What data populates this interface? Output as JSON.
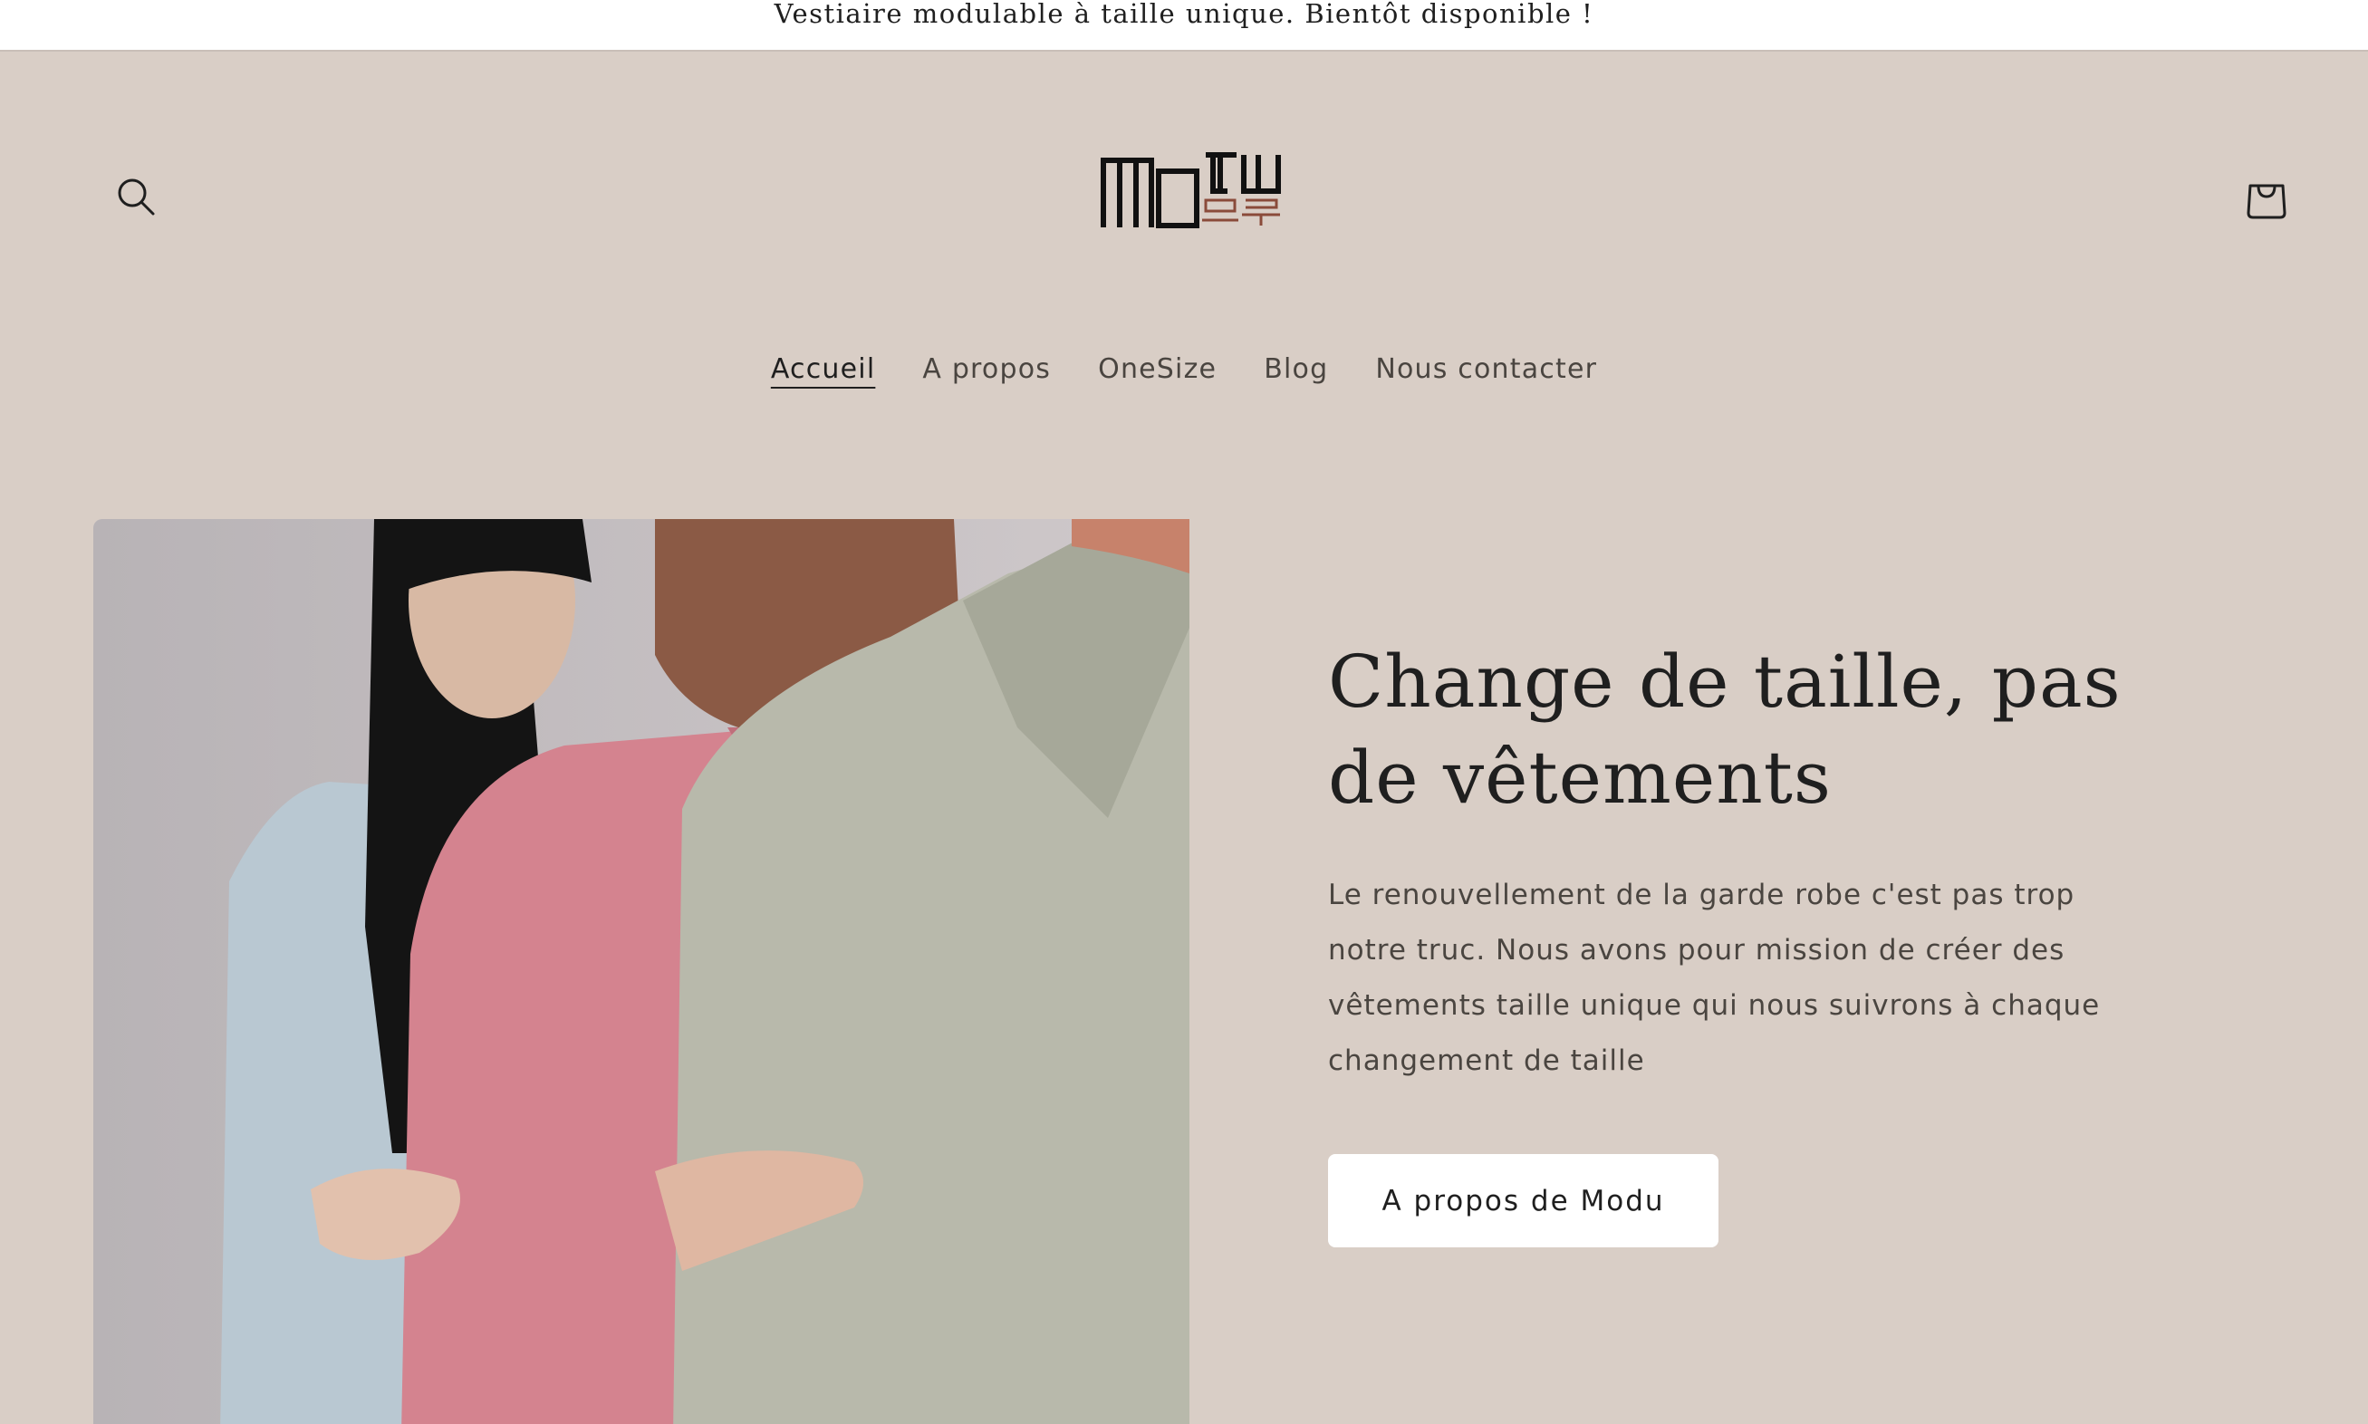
{
  "announcement": {
    "text": "Vestiaire modulable à taille unique. Bientôt disponible !"
  },
  "header": {
    "logo": {
      "latin": "MODU",
      "hangul": "모두"
    },
    "search_icon": "search-icon",
    "cart_icon": "bag-icon"
  },
  "nav": {
    "items": [
      {
        "label": "Accueil",
        "active": true
      },
      {
        "label": "A propos",
        "active": false
      },
      {
        "label": "OneSize",
        "active": false
      },
      {
        "label": "Blog",
        "active": false
      },
      {
        "label": "Nous contacter",
        "active": false
      }
    ]
  },
  "hero": {
    "title": "Change de taille, pas de vêtements",
    "description": "Le renouvellement de la garde robe c'est pas trop notre truc. Nous avons pour mission de créer des vêtements taille unique qui nous suivrons à chaque changement de taille",
    "cta_label": "A propos de Modu"
  },
  "colors": {
    "background": "#d9cec6",
    "announcement_bg": "#ffffff",
    "text": "#1f1f1f",
    "muted_text": "#4a4540",
    "button_bg": "#ffffff"
  }
}
